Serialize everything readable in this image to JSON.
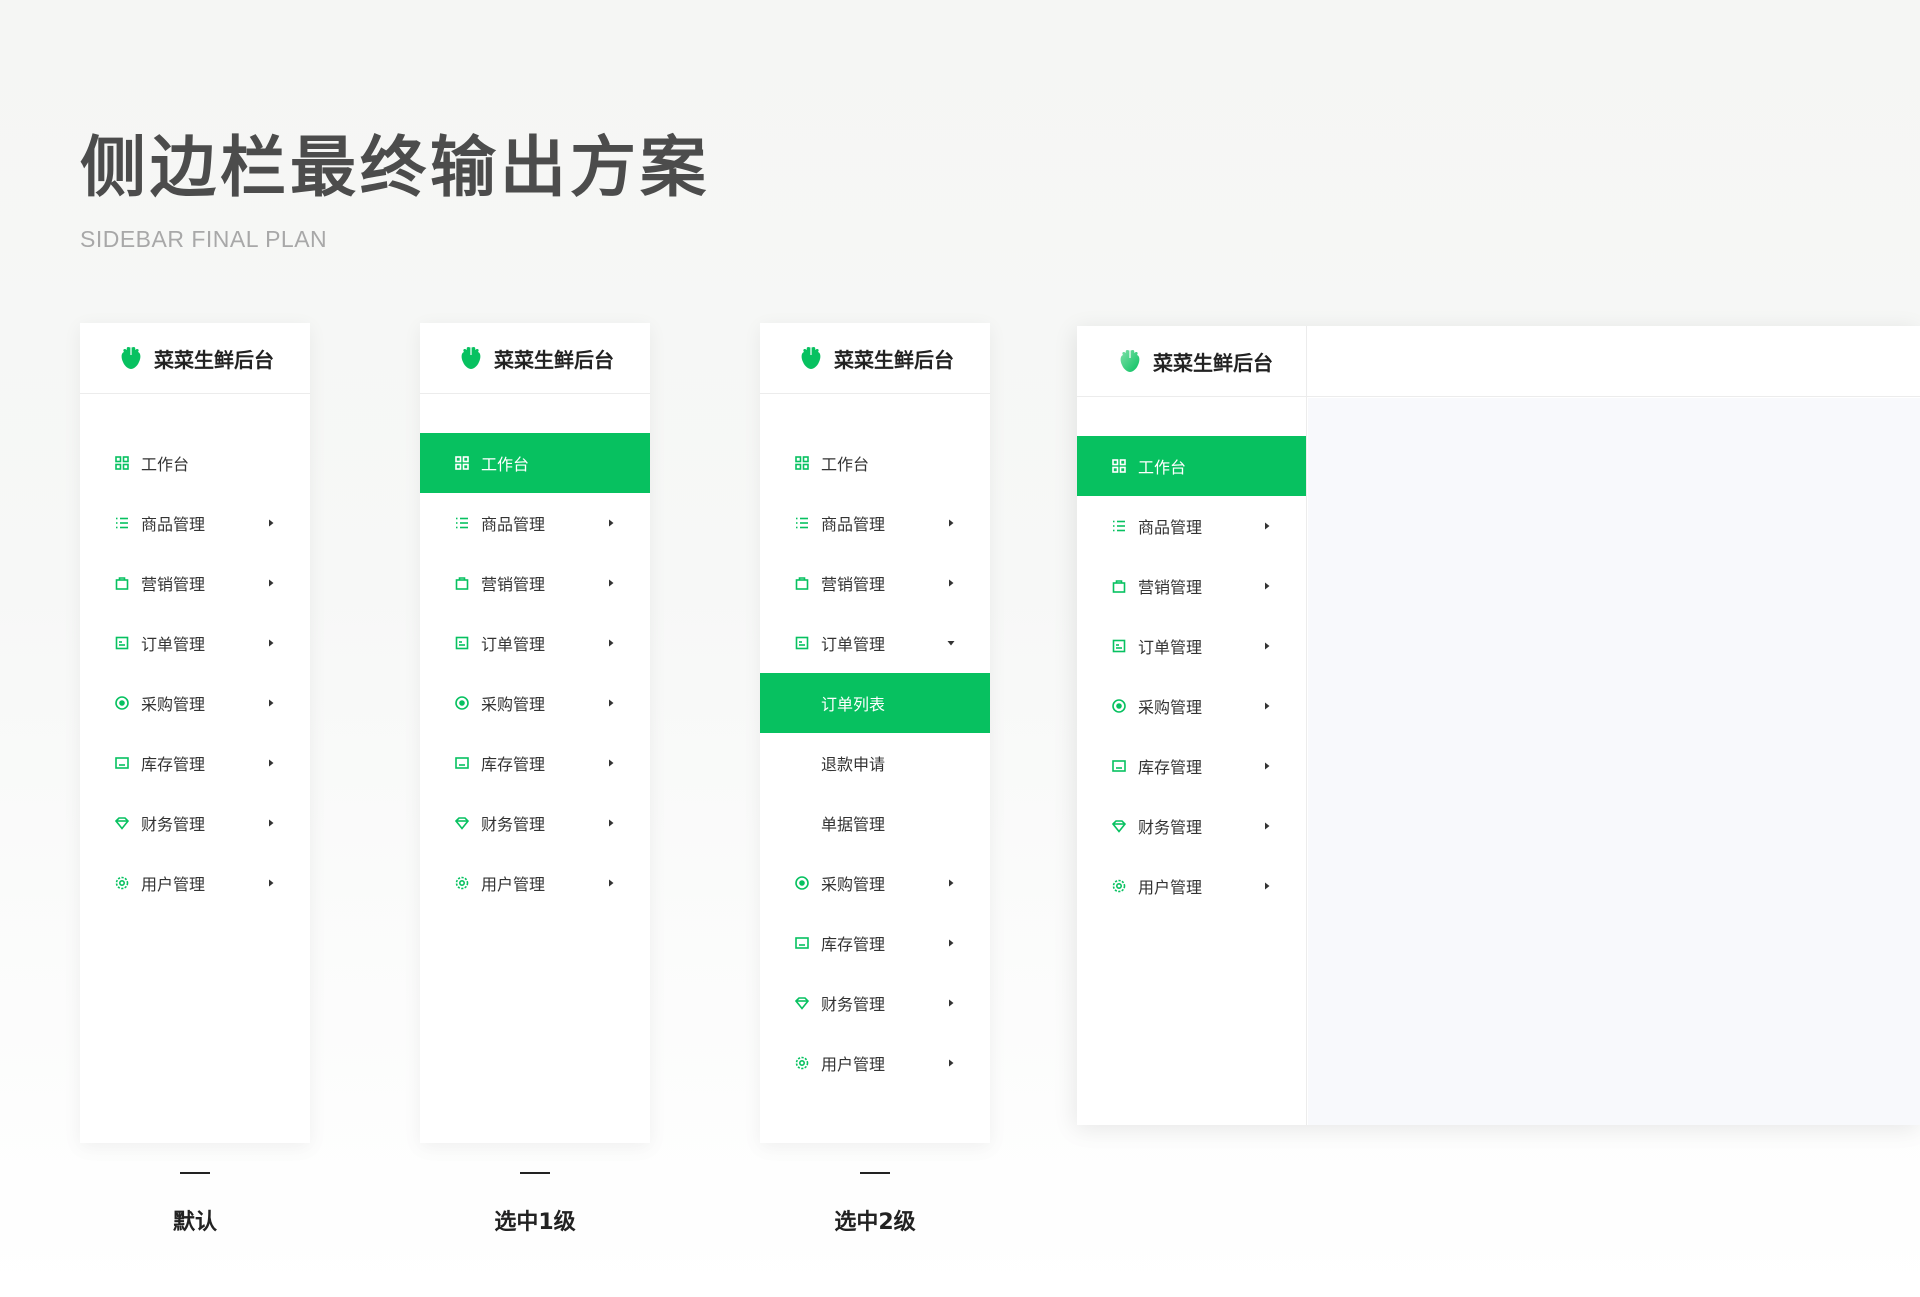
{
  "page": {
    "title": "侧边栏最终输出方案",
    "subtitle": "SIDEBAR FINAL PLAN"
  },
  "brand": {
    "name": "菜菜生鲜后台",
    "accent": "#07c160",
    "logo_icon": "radish-logo-icon"
  },
  "menu": {
    "workbench": "工作台",
    "goods": "商品管理",
    "marketing": "营销管理",
    "orders": "订单管理",
    "purchase": "采购管理",
    "inventory": "库存管理",
    "finance": "财务管理",
    "users": "用户管理",
    "order_sub": {
      "list": "订单列表",
      "refund": "退款申请",
      "docs": "单据管理"
    }
  },
  "icons": {
    "workbench": "grid-icon",
    "goods": "list-icon",
    "marketing": "bag-icon",
    "orders": "receipt-icon",
    "purchase": "target-icon",
    "inventory": "inbox-icon",
    "finance": "diamond-icon",
    "users": "gear-icon",
    "collapsed": "caret-right-icon",
    "expanded": "caret-down-icon"
  },
  "captions": {
    "default": "默认",
    "level1": "选中1级",
    "level2": "选中2级"
  }
}
